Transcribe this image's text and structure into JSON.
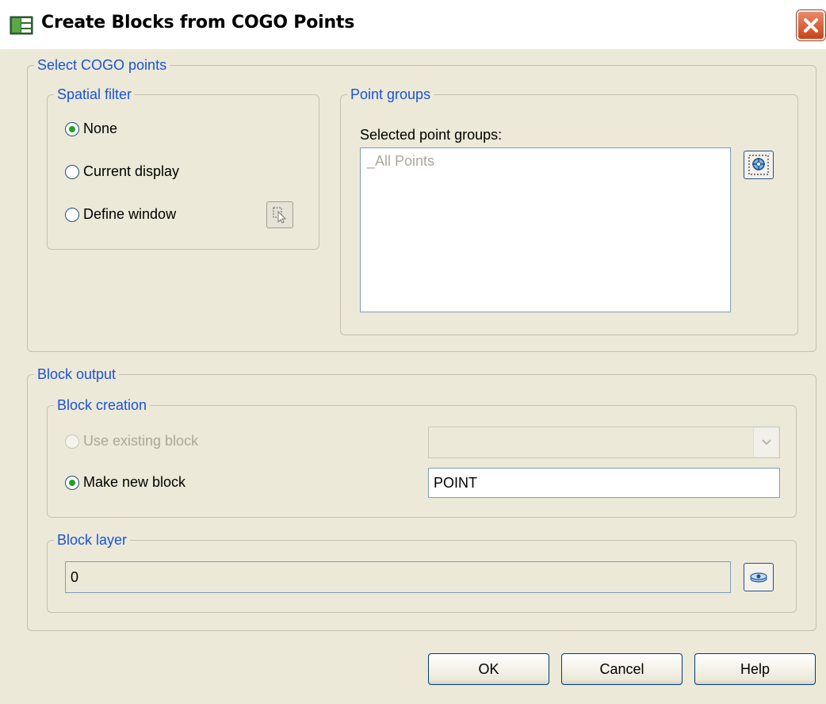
{
  "window": {
    "title": "Create Blocks from COGO Points",
    "close_label": "✕"
  },
  "select_points": {
    "legend": "Select COGO points",
    "spatial_filter": {
      "legend": "Spatial filter",
      "options": [
        {
          "label": "None",
          "selected": true
        },
        {
          "label": "Current display",
          "selected": false
        },
        {
          "label": "Define window",
          "selected": false
        }
      ],
      "pick_icon": "pick-window-icon"
    },
    "point_groups": {
      "legend": "Point groups",
      "list_label": "Selected point groups:",
      "items": [
        "_All Points"
      ],
      "select_icon": "point-group-select-icon"
    }
  },
  "block_output": {
    "legend": "Block output",
    "block_creation": {
      "legend": "Block creation",
      "use_existing_label": "Use existing block",
      "use_existing_value": "",
      "make_new_label": "Make new block",
      "make_new_value": "POINT",
      "selected": "make_new"
    },
    "block_layer": {
      "legend": "Block layer",
      "value": "0",
      "layer_icon": "layer-select-icon"
    }
  },
  "buttons": {
    "ok": "OK",
    "cancel": "Cancel",
    "help": "Help"
  },
  "colors": {
    "legend_blue": "#1a52d8",
    "dialog_bg": "#ece9d8",
    "radio_dot": "#21a121",
    "close_red": "#c9431a"
  }
}
